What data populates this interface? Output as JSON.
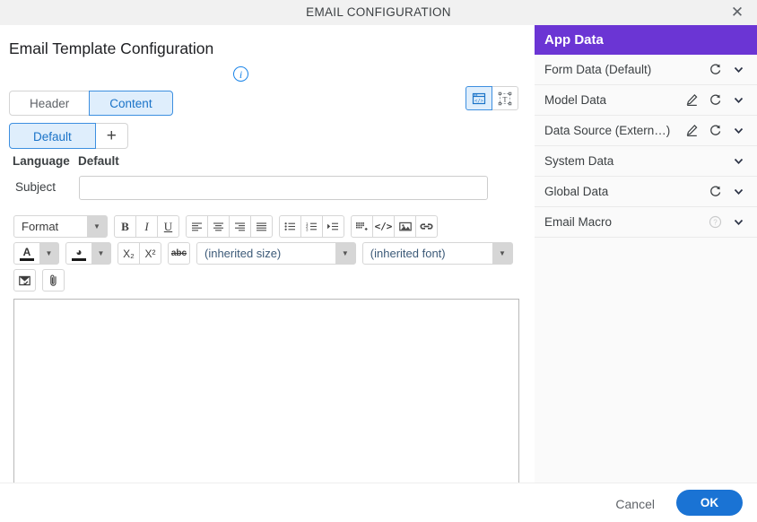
{
  "window": {
    "title": "EMAIL CONFIGURATION",
    "close_icon": "close-icon"
  },
  "page": {
    "title": "Email Template Configuration",
    "info_icon": "info-icon"
  },
  "tabs": [
    {
      "label": "Header",
      "active": false
    },
    {
      "label": "Content",
      "active": true
    }
  ],
  "mode_toggle": [
    {
      "icon": "source-code-view-icon",
      "active": true
    },
    {
      "icon": "plain-text-view-icon",
      "active": false
    }
  ],
  "languages": {
    "chips": [
      {
        "label": "Default",
        "active": true
      }
    ],
    "add_label": "+"
  },
  "form": {
    "language_label": "Language",
    "language_value": "Default",
    "subject_label": "Subject",
    "subject_value": "",
    "subject_placeholder": ""
  },
  "editor": {
    "format_select": {
      "value": "Format"
    },
    "size_select": {
      "value": "(inherited size)"
    },
    "font_select": {
      "value": "(inherited font)"
    },
    "text_color_glyph": "A",
    "bg_color_glyph": "◕",
    "body_value": "",
    "toolbar_row1": [
      {
        "name": "bold-icon",
        "label": "B"
      },
      {
        "name": "italic-icon",
        "label": "I"
      },
      {
        "name": "underline-icon",
        "label": "U"
      },
      {
        "name": "align-left-icon",
        "label": ""
      },
      {
        "name": "align-center-icon",
        "label": ""
      },
      {
        "name": "align-right-icon",
        "label": ""
      },
      {
        "name": "align-justify-icon",
        "label": ""
      },
      {
        "name": "bulleted-list-icon",
        "label": ""
      },
      {
        "name": "numbered-list-icon",
        "label": ""
      },
      {
        "name": "indent-icon",
        "label": ""
      },
      {
        "name": "insert-table-icon",
        "label": ""
      },
      {
        "name": "source-code-icon",
        "label": "</>"
      },
      {
        "name": "insert-image-icon",
        "label": ""
      },
      {
        "name": "insert-link-icon",
        "label": ""
      }
    ],
    "toolbar_row2": [
      {
        "name": "subscript-icon",
        "label": "X₂"
      },
      {
        "name": "superscript-icon",
        "label": "X²"
      },
      {
        "name": "strikethrough-icon",
        "label": "abc"
      }
    ],
    "toolbar_row3": [
      {
        "name": "email-template-icon",
        "label": ""
      },
      {
        "name": "attachment-icon",
        "label": ""
      }
    ]
  },
  "app_data": {
    "header": "App Data",
    "rows": [
      {
        "label": "Form Data (Default)",
        "edit": false,
        "refresh": true,
        "help": false,
        "chevron": true
      },
      {
        "label": "Model Data",
        "edit": true,
        "refresh": true,
        "help": false,
        "chevron": true
      },
      {
        "label": "Data Source (Extern…)",
        "edit": true,
        "refresh": true,
        "help": false,
        "chevron": true
      },
      {
        "label": "System Data",
        "edit": false,
        "refresh": false,
        "help": false,
        "chevron": true
      },
      {
        "label": "Global Data",
        "edit": false,
        "refresh": true,
        "help": false,
        "chevron": true
      },
      {
        "label": "Email Macro",
        "edit": false,
        "refresh": false,
        "help": true,
        "chevron": true
      }
    ]
  },
  "footer": {
    "cancel_label": "Cancel",
    "ok_label": "OK"
  },
  "colors": {
    "accent_purple": "#6b35d4",
    "accent_blue": "#1a73d4",
    "tab_active_bg": "#dfeefc",
    "tab_active_border": "#3d8fe0",
    "titlebar_bg": "#f1f1f1"
  }
}
